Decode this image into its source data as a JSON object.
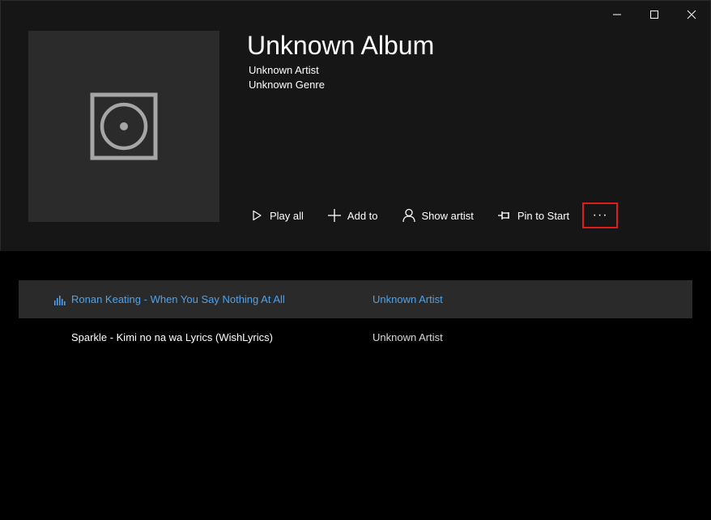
{
  "window": {
    "caption": {
      "minimize_icon": "minimize-icon",
      "maximize_icon": "maximize-icon",
      "close_icon": "close-icon"
    }
  },
  "album": {
    "title": "Unknown Album",
    "artist": "Unknown Artist",
    "genre": "Unknown Genre",
    "art_icon": "disc-placeholder-icon"
  },
  "actions": {
    "play_all": "Play all",
    "add_to": "Add to",
    "show_artist": "Show artist",
    "pin_to_start": "Pin to Start",
    "more": "···"
  },
  "tracks": [
    {
      "title": "Ronan Keating - When You Say Nothing At All",
      "artist": "Unknown Artist",
      "playing": true
    },
    {
      "title": "Sparkle - Kimi no na wa Lyrics (WishLyrics)",
      "artist": "Unknown Artist",
      "playing": false
    }
  ],
  "colors": {
    "accent": "#4aa3f0",
    "header_bg": "#161616",
    "selected_row_bg": "#2a2a2a",
    "highlight_box": "#e11b1b"
  }
}
